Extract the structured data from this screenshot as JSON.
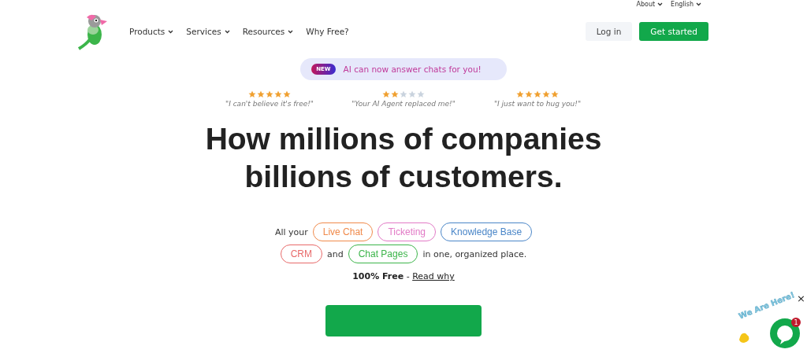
{
  "top_links": [
    {
      "label": "About",
      "dropdown": true
    },
    {
      "label": "English",
      "dropdown": true
    }
  ],
  "nav": [
    {
      "label": "Products",
      "dropdown": true
    },
    {
      "label": "Services",
      "dropdown": true
    },
    {
      "label": "Resources",
      "dropdown": true
    },
    {
      "label": "Why Free?",
      "dropdown": false
    }
  ],
  "login": "Log in",
  "get_started": "Get started",
  "announcement": {
    "badge": "NEW",
    "text": "AI can now answer chats for you!"
  },
  "reviews": [
    {
      "stars": 5,
      "quote": "\"I can't believe it's free!\""
    },
    {
      "stars": 2,
      "quote": "\"Your AI Agent replaced me!\""
    },
    {
      "stars": 5,
      "quote": "\"I just want to hug you!\""
    }
  ],
  "headline": [
    "How millions of companies",
    "billions of customers."
  ],
  "features_line1": {
    "prefix": "All your",
    "pills": [
      {
        "label": "Live Chat",
        "color": "#f08a4b"
      },
      {
        "label": "Ticketing",
        "color": "#e27ac6"
      },
      {
        "label": "Knowledge Base",
        "color": "#4a86c8"
      }
    ]
  },
  "features_line2": {
    "pills": [
      {
        "label": "CRM",
        "color": "#e86a6a"
      }
    ],
    "middle": "and",
    "pills2": [
      {
        "label": "Chat Pages",
        "color": "#3cb54a"
      }
    ],
    "suffix": "in one, organized place."
  },
  "free_note": "**100% Free** - ",
  "read_why": "Read why",
  "chat_widget": {
    "label": "We Are Here!",
    "unread": "1",
    "close": "×"
  }
}
